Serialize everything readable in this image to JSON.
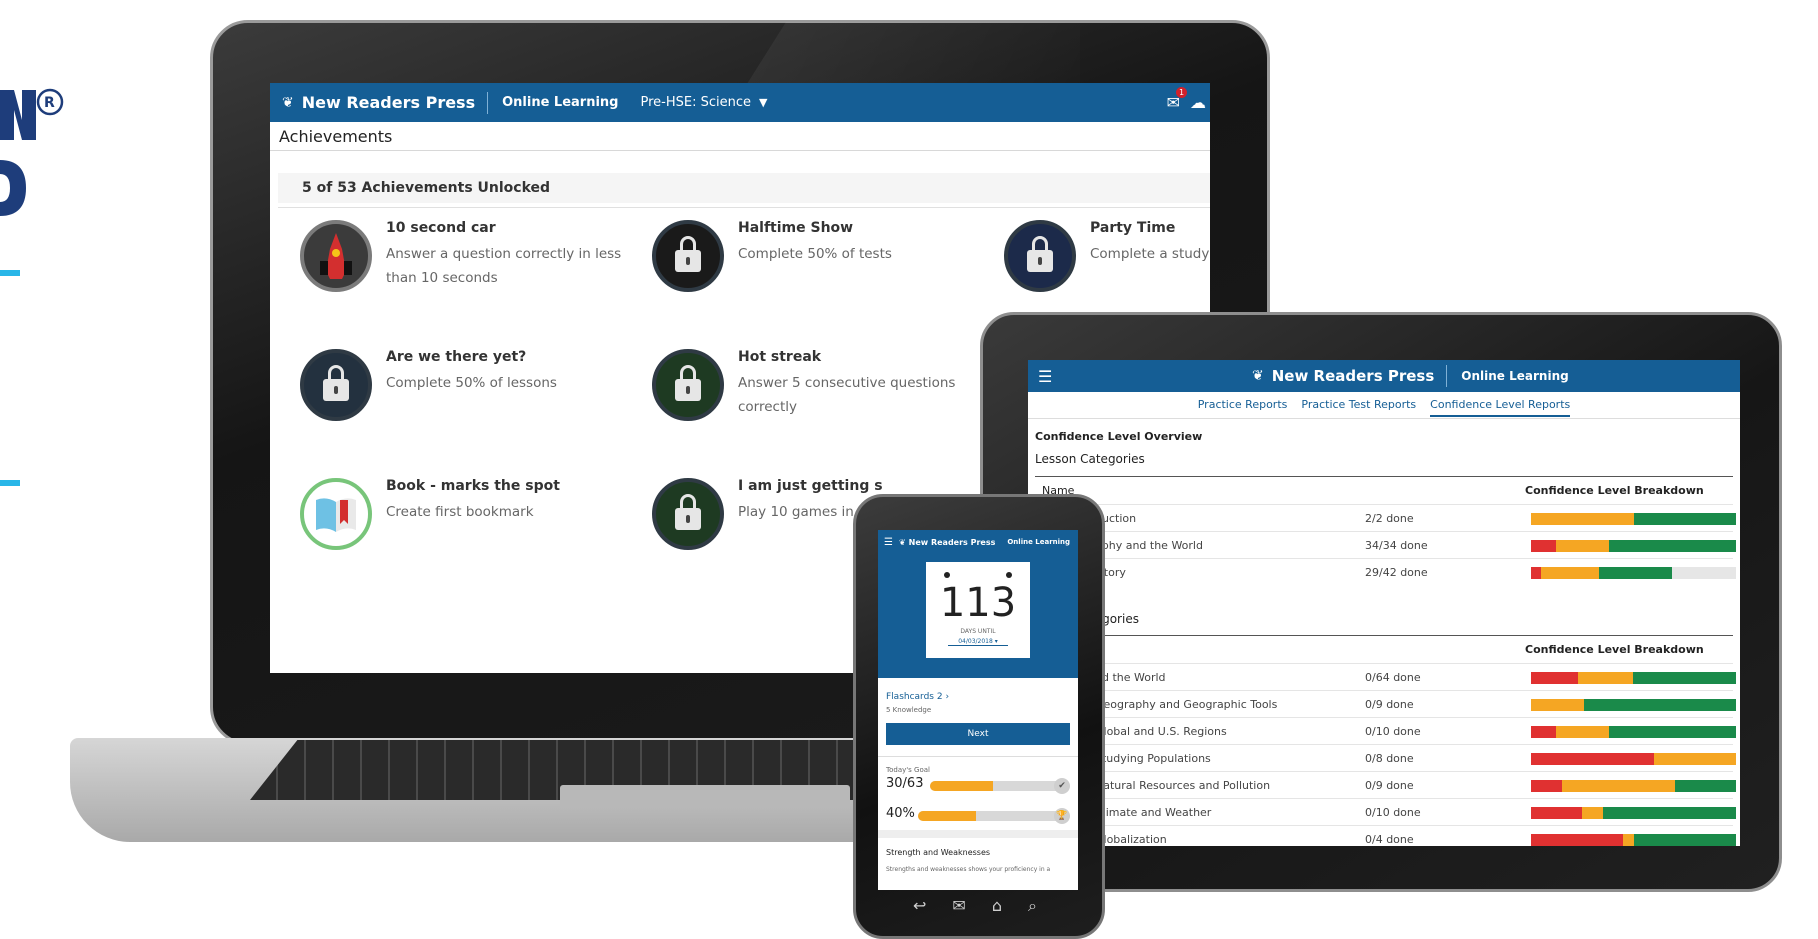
{
  "brand": {
    "name": "New Readers Press",
    "section": "Online Learning",
    "primary": "#155e95"
  },
  "laptop": {
    "subject": "Pre-HSE: Science",
    "notifications": "1",
    "page_title": "Achievements",
    "unlocked_text": "5 of 53 Achievements Unlocked",
    "achievements": [
      {
        "title": "10 second car",
        "desc": "Answer a question correctly in less than 10 seconds",
        "icon": "race-car-icon"
      },
      {
        "title": "Halftime Show",
        "desc": "Complete 50% of tests",
        "icon": "lock-icon"
      },
      {
        "title": "Party Time",
        "desc": "Complete a study",
        "icon": "lock-icon"
      },
      {
        "title": "Are we there yet?",
        "desc": "Complete 50% of lessons",
        "icon": "lock-icon"
      },
      {
        "title": "Hot streak",
        "desc": "Answer 5 consecutive questions correctly",
        "icon": "lock-icon"
      },
      {
        "title": "Book - marks the spot",
        "desc": "Create first bookmark",
        "icon": "book-icon"
      },
      {
        "title": "I am just getting s",
        "desc": "Play 10 games in",
        "icon": "lock-icon"
      }
    ]
  },
  "tablet": {
    "tabs": [
      "Practice Reports",
      "Practice Test Reports",
      "Confidence Level Reports"
    ],
    "overview_title": "Confidence Level Overview",
    "lesson_categories": "Lesson Categories",
    "col_name": "Name",
    "col_conf": "Confidence Level Breakdown",
    "section2_title": "tegories",
    "colors": {
      "red": "#e03131",
      "orange": "#f5a623",
      "green": "#1a8a4a",
      "gray": "#e6e6e6"
    },
    "rows1": [
      {
        "name": "duction",
        "done": "2/2 done",
        "seg": [
          0,
          0.5,
          0.5,
          0
        ]
      },
      {
        "name": "aphy and the World",
        "done": "34/34 done",
        "seg": [
          0.12,
          0.26,
          0.62,
          0
        ]
      },
      {
        "name": "istory",
        "done": "29/42 done",
        "seg": [
          0.05,
          0.28,
          0.36,
          0.31
        ]
      }
    ],
    "rows2": [
      {
        "name": "nd the World",
        "done": "0/64 done",
        "seg": [
          0.23,
          0.27,
          0.5,
          0
        ]
      },
      {
        "name": "Geography and Geographic Tools",
        "done": "0/9 done",
        "seg": [
          0,
          0.26,
          0.74,
          0
        ]
      },
      {
        "name": "Global and U.S. Regions",
        "done": "0/10 done",
        "seg": [
          0.12,
          0.26,
          0.62,
          0
        ]
      },
      {
        "name": "Studying Populations",
        "done": "0/8 done",
        "seg": [
          0.6,
          0.4,
          0,
          0
        ]
      },
      {
        "name": "Natural Resources and Pollution",
        "done": "0/9 done",
        "seg": [
          0.15,
          0.55,
          0.3,
          0
        ]
      },
      {
        "name": "Climate and Weather",
        "done": "0/10 done",
        "seg": [
          0.25,
          0.1,
          0.65,
          0
        ]
      },
      {
        "name": "Globalization",
        "done": "0/4 done",
        "seg": [
          0.45,
          0.05,
          0.5,
          0
        ]
      }
    ]
  },
  "phone": {
    "days": "113",
    "days_until": "DAYS UNTIL",
    "date": "04/03/2018 ▾",
    "flash_title": "Flashcards 2   ›",
    "flash_sub": "5 Knowledge",
    "next_label": "Next",
    "goal_label": "Today's Goal",
    "goal_value": "30/63",
    "goal_fraction": 0.48,
    "pct_value": "40%",
    "pct_fraction": 0.4,
    "sw_title": "Strength and Weaknesses",
    "sw_desc": "Strengths and weaknesses shows your proficiency in a"
  }
}
